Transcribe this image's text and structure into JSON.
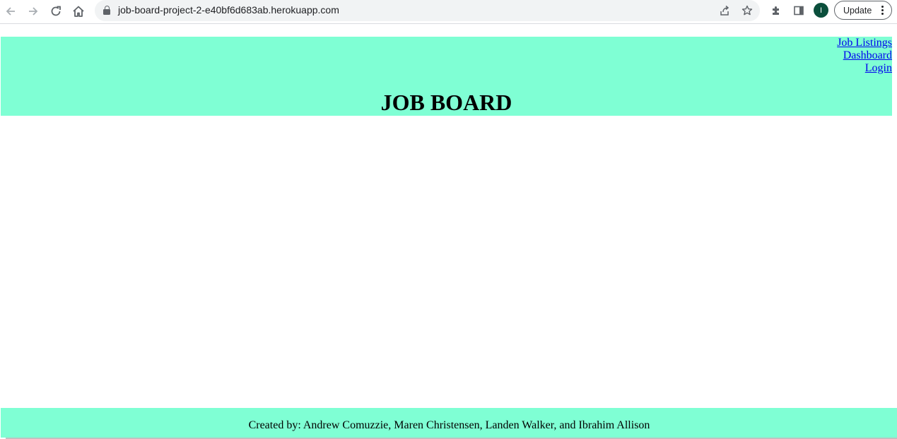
{
  "browser": {
    "url": "job-board-project-2-e40bf6d683ab.herokuapp.com",
    "avatar_initial": "I",
    "update_label": "Update"
  },
  "header": {
    "nav_links": [
      {
        "label": "Job Listings"
      },
      {
        "label": "Dashboard"
      },
      {
        "label": "Login"
      }
    ],
    "title": "JOB BOARD"
  },
  "footer": {
    "credits": "Created by: Andrew Comuzzie, Maren Christensen, Landen Walker, and Ibrahim Allison"
  },
  "colors": {
    "header_bg": "#7fffd4",
    "link": "#0000ee",
    "avatar_bg": "#0b4f3c"
  },
  "icons": [
    "back-arrow-icon",
    "forward-arrow-icon",
    "reload-icon",
    "home-icon",
    "lock-icon",
    "share-icon",
    "bookmark-star-icon",
    "extensions-puzzle-icon",
    "side-panel-icon",
    "more-vertical-icon"
  ]
}
